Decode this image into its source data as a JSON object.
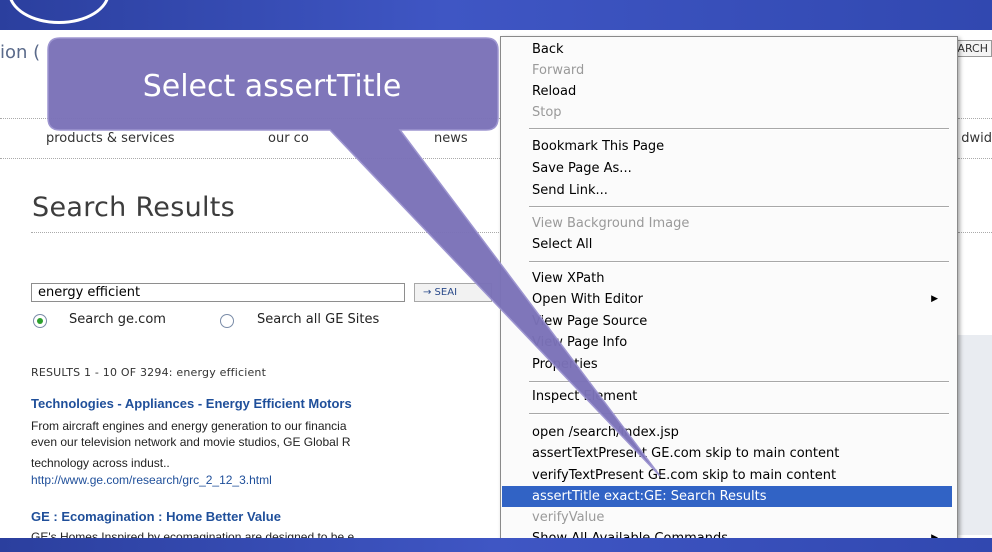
{
  "page": {
    "left_fragment": "ion (",
    "search_fragment": "ARCH",
    "nav": [
      "products & services",
      "our co",
      "news"
    ],
    "nav_right": "dwid",
    "title": "Search Results",
    "search_value": "energy efficient",
    "search_button": "→ SEAI",
    "radio_ge": "Search ge.com",
    "radio_all": "Search all GE Sites",
    "results_count": "RESULTS 1 - 10 OF 3294: energy efficient",
    "results": [
      {
        "title": "Technologies - Appliances - Energy Efficient Motors",
        "lines": [
          "From aircraft engines and energy generation to our financia",
          "even our television network and movie studios, GE Global R",
          "technology across indust.."
        ],
        "link": "http://www.ge.com/research/grc_2_12_3.html"
      },
      {
        "title": "GE : Ecomagination : Home Better Value",
        "lines": [
          "GE's Homes Inspired by ecomagination are designed to be e"
        ]
      }
    ]
  },
  "context_menu": {
    "items": [
      {
        "label": "Back",
        "disabled": false
      },
      {
        "label": "Forward",
        "disabled": true
      },
      {
        "label": "Reload",
        "disabled": false
      },
      {
        "label": "Stop",
        "disabled": true
      },
      {
        "label": "Bookmark This Page",
        "disabled": false
      },
      {
        "label": "Save Page As...",
        "disabled": false
      },
      {
        "label": "Send Link...",
        "disabled": false
      },
      {
        "label": "View Background Image",
        "disabled": true
      },
      {
        "label": "Select All",
        "disabled": false
      },
      {
        "label": "View XPath",
        "disabled": false
      },
      {
        "label": "Open With Editor",
        "disabled": false,
        "submenu": true
      },
      {
        "label": "View Page Source",
        "disabled": false
      },
      {
        "label": "View Page Info",
        "disabled": false
      },
      {
        "label": "Properties",
        "disabled": false
      },
      {
        "label": "Inspect Element",
        "disabled": false
      },
      {
        "label": "open /search/index.jsp",
        "disabled": false
      },
      {
        "label": "assertTextPresent GE.com skip to main content",
        "disabled": false
      },
      {
        "label": "verifyTextPresent GE.com skip to main content",
        "disabled": false
      },
      {
        "label": "assertTitle exact:GE: Search Results",
        "disabled": false,
        "selected": true
      },
      {
        "label": "verifyValue",
        "disabled": true
      },
      {
        "label": "Show All Available Commands",
        "disabled": false,
        "submenu": true
      }
    ]
  },
  "callout": {
    "text": "Select assertTitle"
  },
  "colors": {
    "slide_blue": "#3148b0",
    "callout_fill": "#7b72b8",
    "menu_highlight": "#3163c5",
    "link_blue": "#1f4f9a"
  },
  "icons": {
    "submenu": "submenu-arrow-icon",
    "radio": "radio-icon"
  }
}
